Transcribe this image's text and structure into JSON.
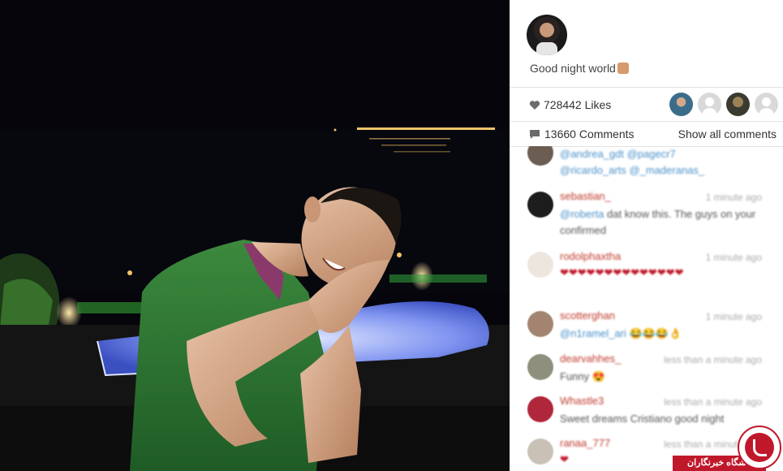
{
  "post": {
    "caption": "Good night world",
    "caption_emoji": "thumbs-up-emoji",
    "likes_count": "728442",
    "likes_label": "Likes",
    "comments_count": "13660",
    "comments_label": "Comments",
    "show_all_label": "Show all comments"
  },
  "comments": [
    {
      "user": "",
      "time": "",
      "text_mention": "@andrea_gdt @pagecr7",
      "text": "@ricardo_arts @_maderanas_"
    },
    {
      "user": "sebastian_",
      "time": "1 minute ago",
      "text_mention": "@roberta",
      "text": "dat know this. The guys on your confirmed"
    },
    {
      "user": "rodolphaxtha",
      "time": "1 minute ago",
      "text": "",
      "hearts": "❤❤❤❤❤❤❤❤❤❤❤❤❤❤"
    },
    {
      "user": "scotterghan",
      "time": "1 minute ago",
      "text_mention": "@n1ramel_ari",
      "text": "😂😂😂👌"
    },
    {
      "user": "dearvahhes_",
      "time": "less than a minute ago",
      "text": "Funny 😍"
    },
    {
      "user": "Whastle3",
      "time": "less than a minute ago",
      "text": "Sweet dreams Cristiano good night"
    },
    {
      "user": "ranaa_777",
      "time": "less than a minute ago",
      "text": "❤"
    }
  ],
  "watermark": {
    "label": "باشگاه خبرنگاران"
  },
  "colors": {
    "username": "#c0392b",
    "mention": "#4a90c8",
    "watermark": "#c0182b"
  }
}
